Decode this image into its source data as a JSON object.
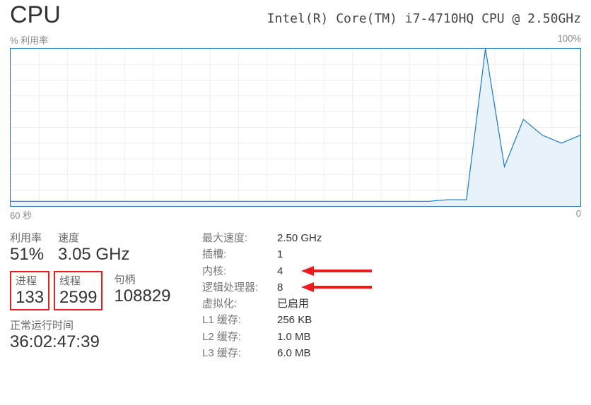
{
  "header": {
    "title": "CPU",
    "cpu_name": "Intel(R) Core(TM) i7-4710HQ CPU @ 2.50GHz"
  },
  "chart_labels": {
    "top_left": "% 利用率",
    "top_right": "100%",
    "bottom_left": "60 秒",
    "bottom_right": "0"
  },
  "chart_data": {
    "type": "line",
    "title": "% 利用率",
    "xlabel": "60 秒",
    "ylabel": "",
    "ylim": [
      0,
      100
    ],
    "xlim": [
      60,
      0
    ],
    "x": [
      60,
      58,
      56,
      54,
      52,
      50,
      48,
      46,
      44,
      42,
      40,
      38,
      36,
      34,
      32,
      30,
      28,
      26,
      24,
      22,
      20,
      18,
      16,
      14,
      12,
      10,
      8,
      6,
      4,
      2,
      0
    ],
    "values": [
      3,
      3,
      3,
      3,
      3,
      3,
      3,
      3,
      3,
      3,
      3,
      3,
      3,
      3,
      3,
      3,
      3,
      3,
      3,
      3,
      3,
      3,
      3,
      4,
      4,
      100,
      25,
      55,
      45,
      40,
      45
    ]
  },
  "stats": {
    "utilization_label": "利用率",
    "utilization_value": "51%",
    "speed_label": "速度",
    "speed_value": "3.05 GHz",
    "processes_label": "进程",
    "processes_value": "133",
    "threads_label": "线程",
    "threads_value": "2599",
    "handles_label": "句柄",
    "handles_value": "108829",
    "uptime_label": "正常运行时间",
    "uptime_value": "36:02:47:39"
  },
  "details": {
    "max_speed_label": "最大速度:",
    "max_speed_value": "2.50 GHz",
    "sockets_label": "插槽:",
    "sockets_value": "1",
    "cores_label": "内核:",
    "cores_value": "4",
    "logical_label": "逻辑处理器:",
    "logical_value": "8",
    "virt_label": "虚拟化:",
    "virt_value": "已启用",
    "l1_label": "L1 缓存:",
    "l1_value": "256 KB",
    "l2_label": "L2 缓存:",
    "l2_value": "1.0 MB",
    "l3_label": "L3 缓存:",
    "l3_value": "6.0 MB"
  }
}
